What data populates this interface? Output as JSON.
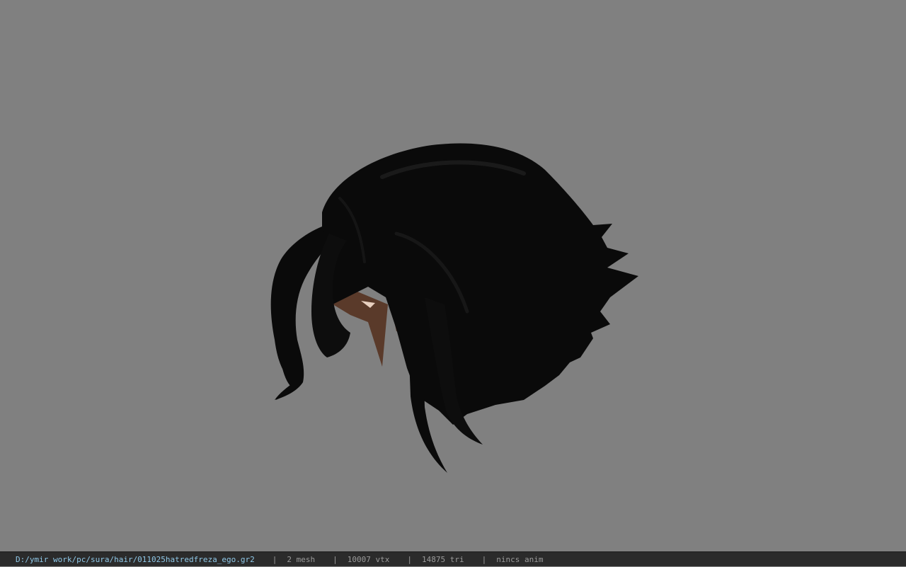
{
  "viewport": {
    "background_color": "#808080",
    "model": {
      "hair_color": "#0a0a0a",
      "skin_color": "#5a3a2a"
    }
  },
  "statusbar": {
    "background_color": "#2b2b2b",
    "path_color": "#8fc8e8",
    "file_path": "D:/ymir work/pc/sura/hair/011025hatredfreza_ego.gr2",
    "separator": "|",
    "mesh_count": "2 mesh",
    "vertex_count": "10007 vtx",
    "triangle_count": "14875 tri",
    "animation_status": "nincs anim"
  }
}
